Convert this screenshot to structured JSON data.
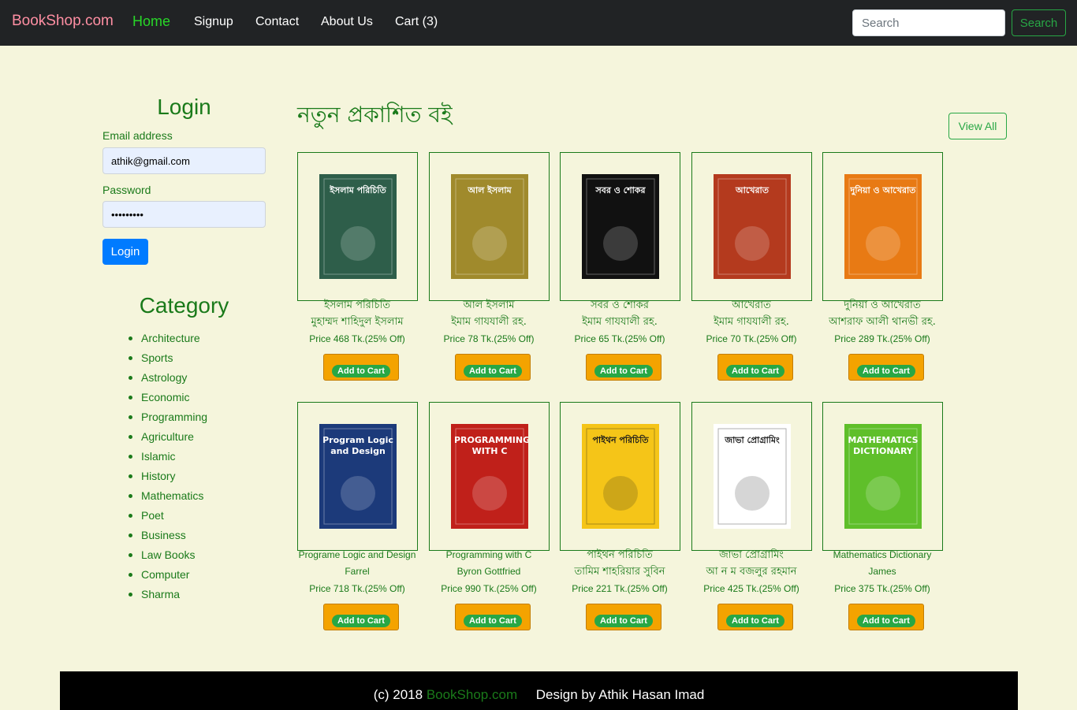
{
  "nav": {
    "brand": "BookShop.com",
    "links": [
      "Home",
      "Signup",
      "Contact",
      "About Us",
      "Cart (3)"
    ],
    "search_placeholder": "Search",
    "search_button": "Search"
  },
  "login": {
    "title": "Login",
    "email_label": "Email address",
    "email_value": "athik@gmail.com",
    "password_label": "Password",
    "password_value": "•••••••••",
    "button": "Login"
  },
  "category": {
    "title": "Category",
    "items": [
      "Architecture",
      "Sports",
      "Astrology",
      "Economic",
      "Programming",
      "Agriculture",
      "Islamic",
      "History",
      "Mathematics",
      "Poet",
      "Business",
      "Law Books",
      "Computer",
      "Sharma"
    ]
  },
  "section": {
    "title": "নতুন প্রকাশিত বই",
    "view_all": "View All"
  },
  "books": [
    {
      "title": "ইসলাম পরিচিতি",
      "author": "মুহাম্মদ শাহিদুল ইসলাম",
      "price": "Price 468 Tk.(25% Off)",
      "cover_text": "ইসলাম পরিচিতি",
      "cover_color": "#2e5e4a"
    },
    {
      "title": "আল ইসলাম",
      "author": "ইমাম গাযযালী রহ.",
      "price": "Price 78 Tk.(25% Off)",
      "cover_text": "আল ইসলাম",
      "cover_color": "#a08a2c"
    },
    {
      "title": "সবর ও শোকর",
      "author": "ইমাম গাযযালী রহ.",
      "price": "Price 65 Tk.(25% Off)",
      "cover_text": "সবর ও শোকর",
      "cover_color": "#111111"
    },
    {
      "title": "আখেরাত",
      "author": "ইমাম গাযযালী রহ.",
      "price": "Price 70 Tk.(25% Off)",
      "cover_text": "আখেরাত",
      "cover_color": "#b43a1e"
    },
    {
      "title": "দুনিয়া ও আখেরাত",
      "author": "আশরাফ আলী থানভী রহ.",
      "price": "Price 289 Tk.(25% Off)",
      "cover_text": "দুনিয়া ও আখেরাত",
      "cover_color": "#e87a14"
    },
    {
      "title": "Programe Logic and Design",
      "author": "Farrel",
      "price": "Price 718 Tk.(25% Off)",
      "cover_text": "Program Logic and Design",
      "cover_color": "#1c3a7a"
    },
    {
      "title": "Programming with C",
      "author": "Byron Gottfried",
      "price": "Price 990 Tk.(25% Off)",
      "cover_text": "PROGRAMMING WITH C",
      "cover_color": "#c0201a"
    },
    {
      "title": "পাইথন পরিচিতি",
      "author": "তামিম শাহরিয়ার সুবিন",
      "price": "Price 221 Tk.(25% Off)",
      "cover_text": "পাইথন পরিচিতি",
      "cover_color": "#f5c518"
    },
    {
      "title": "জাভা প্রোগ্রামিং",
      "author": "আ ন ম বজলুর রহমান",
      "price": "Price 425 Tk.(25% Off)",
      "cover_text": "জাভা প্রোগ্রামিং",
      "cover_color": "#ffffff"
    },
    {
      "title": "Mathematics Dictionary",
      "author": "James",
      "price": "Price 375 Tk.(25% Off)",
      "cover_text": "MATHEMATICS DICTIONARY",
      "cover_color": "#5fbf2a"
    }
  ],
  "cart_button": "Add to Cart",
  "footer": {
    "copyright": "(c) 2018",
    "brand": "BookShop.com",
    "credit": "Design by Athik Hasan Imad"
  }
}
